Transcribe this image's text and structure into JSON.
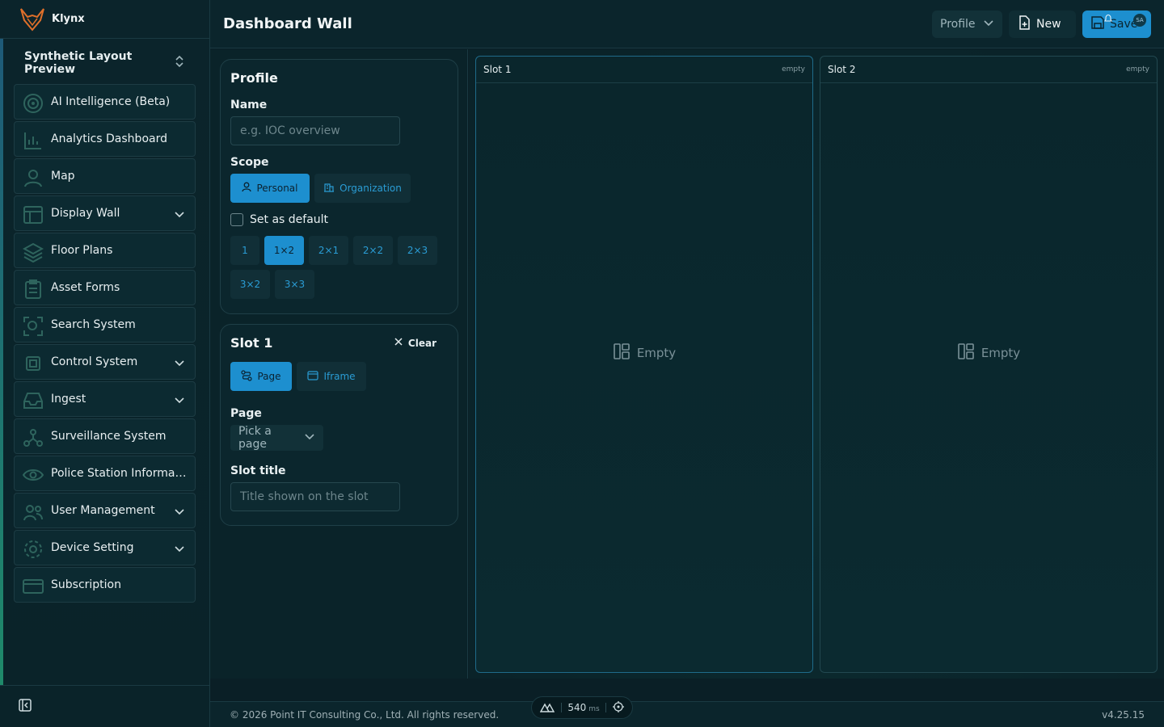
{
  "app": {
    "name": "Klynx",
    "workspace": "Synthetic Layout Preview"
  },
  "sidebar": {
    "items": [
      {
        "label": "AI Intelligence (Beta)",
        "icon": "target-icon",
        "expandable": false
      },
      {
        "label": "Analytics Dashboard",
        "icon": "chart-icon",
        "expandable": false
      },
      {
        "label": "Map",
        "icon": "person-pin-icon",
        "expandable": false
      },
      {
        "label": "Display Wall",
        "icon": "layout-icon",
        "expandable": true
      },
      {
        "label": "Floor Plans",
        "icon": "layers-icon",
        "expandable": false
      },
      {
        "label": "Asset Forms",
        "icon": "clipboard-icon",
        "expandable": false
      },
      {
        "label": "Search System",
        "icon": "scan-icon",
        "expandable": false
      },
      {
        "label": "Control System",
        "icon": "cpu-icon",
        "expandable": true
      },
      {
        "label": "Ingest",
        "icon": "inbox-icon",
        "expandable": true
      },
      {
        "label": "Surveillance System",
        "icon": "network-icon",
        "expandable": false
      },
      {
        "label": "Police Station Informati...",
        "icon": "eye-icon",
        "expandable": false
      },
      {
        "label": "User Management",
        "icon": "users-icon",
        "expandable": true
      },
      {
        "label": "Device Setting",
        "icon": "gear-icon",
        "expandable": true
      },
      {
        "label": "Subscription",
        "icon": "credit-card-icon",
        "expandable": false
      }
    ]
  },
  "header": {
    "title": "Dashboard Wall",
    "profile_label": "Profile",
    "new_label": "New",
    "save_label": "Save",
    "avatar_initials": "SA"
  },
  "profile_card": {
    "title": "Profile",
    "name_label": "Name",
    "name_placeholder": "e.g. IOC overview",
    "scope_label": "Scope",
    "scope_personal": "Personal",
    "scope_org": "Organization",
    "default_label": "Set as default",
    "layouts": [
      "1",
      "1×2",
      "2×1",
      "2×2",
      "2×3",
      "3×2",
      "3×3"
    ],
    "selected_layout": "1×2"
  },
  "slot_card": {
    "title": "Slot 1",
    "clear_label": "Clear",
    "type_page": "Page",
    "type_iframe": "Iframe",
    "page_label": "Page",
    "page_select": "Pick a page",
    "slot_title_label": "Slot title",
    "slot_title_placeholder": "Title shown on the slot"
  },
  "slots": [
    {
      "title": "Slot 1",
      "state": "empty",
      "empty_label": "Empty"
    },
    {
      "title": "Slot 2",
      "state": "empty",
      "empty_label": "Empty"
    }
  ],
  "footer": {
    "copyright": "© 2026 Point IT Consulting Co., Ltd. All rights reserved.",
    "version": "v4.25.15",
    "latency_value": "540",
    "latency_unit": "ms"
  },
  "colors": {
    "accent": "#1d8fcf",
    "bg": "#0a2329",
    "brand": "#e0702a"
  }
}
